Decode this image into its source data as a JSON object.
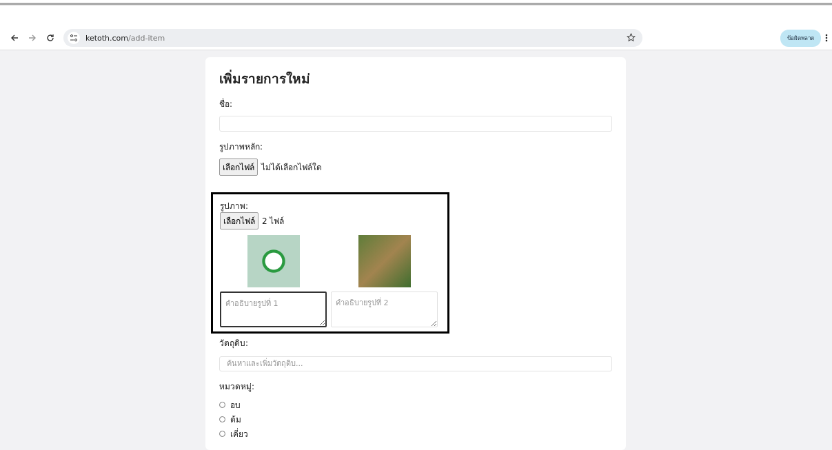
{
  "browser": {
    "url_host": "ketoth.com",
    "url_path": "/add-item",
    "error_chip": "ข้อผิดพลาด"
  },
  "form": {
    "title": "เพิ่มรายการใหม่",
    "name": {
      "label": "ชื่อ:"
    },
    "main_image": {
      "label": "รูปภาพหลัก:",
      "button": "เลือกไฟล์",
      "status": "ไม่ได้เลือกไฟล์ใด"
    },
    "images": {
      "label": "รูปภาพ:",
      "button": "เลือกไฟล์",
      "status": "2 ไฟล์",
      "highlighted": true,
      "items": [
        {
          "placeholder": "คำอธิบายรูปที่ 1",
          "focused": true
        },
        {
          "placeholder": "คำอธิบายรูปที่ 2",
          "focused": false
        }
      ]
    },
    "ingredients": {
      "label": "วัตถุดิบ:",
      "placeholder": "ค้นหาและเพิ่มวัตถุดิบ..."
    },
    "category": {
      "label": "หมวดหมู่:",
      "options": [
        {
          "label": "อบ",
          "selected": false
        },
        {
          "label": "ต้ม",
          "selected": false
        },
        {
          "label": "เคี่ยว",
          "selected": false
        }
      ]
    }
  }
}
